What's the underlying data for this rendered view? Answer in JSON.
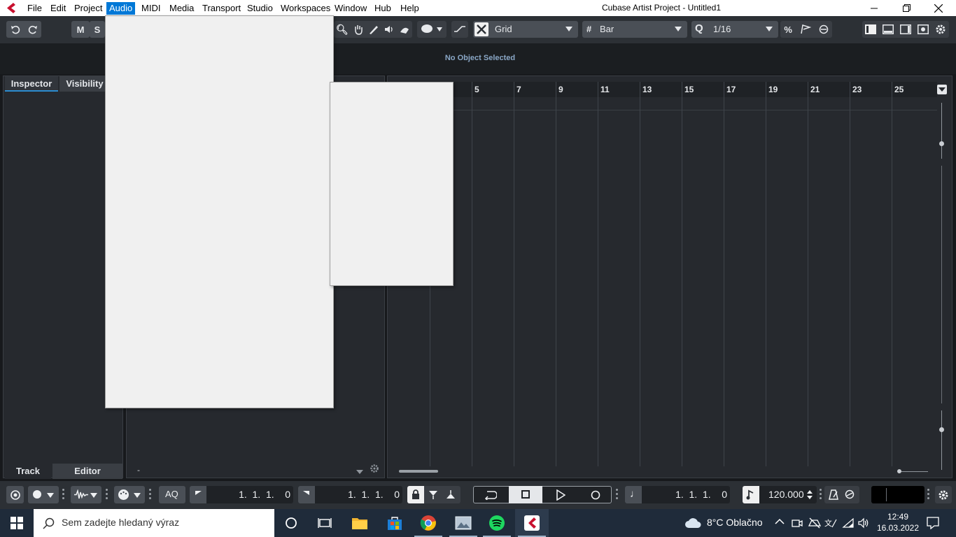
{
  "window": {
    "title": "Cubase Artist Project - Untitled1",
    "menu": [
      "File",
      "Edit",
      "Project",
      "Audio",
      "MIDI",
      "Media",
      "Transport",
      "Studio",
      "Workspaces",
      "Window",
      "Hub",
      "Help"
    ],
    "active_menu": "Audio"
  },
  "toolbar": {
    "mute_label": "M",
    "solo_label": "S",
    "snap_type": "Grid",
    "grid_type": "Bar",
    "quantize_value": "1/16"
  },
  "info_line": {
    "status": "No Object Selected"
  },
  "inspector": {
    "tab_inspector": "Inspector",
    "tab_visibility": "Visibility",
    "tab_track": "Track",
    "tab_editor": "Editor"
  },
  "tracklist": {
    "footer_dash": "-"
  },
  "ruler": {
    "bars": [
      "5",
      "7",
      "9",
      "11",
      "13",
      "15",
      "17",
      "19",
      "21",
      "23",
      "25"
    ]
  },
  "transport": {
    "aq_label": "AQ",
    "left_locator": "1.  1.  1.    0",
    "right_locator": "1.  1.  1.    0",
    "primary_time": "1.  1.  1.    0",
    "tempo": "120.000"
  },
  "taskbar": {
    "search_placeholder": "Sem zadejte hledaný výraz",
    "weather": "8°C  Oblačno",
    "time": "12:49",
    "date": "16.03.2022"
  },
  "colors": {
    "accent": "#2c8cd0",
    "menu_highlight": "#0078d7",
    "cubase_red": "#c8102e",
    "background": "#26292e"
  }
}
